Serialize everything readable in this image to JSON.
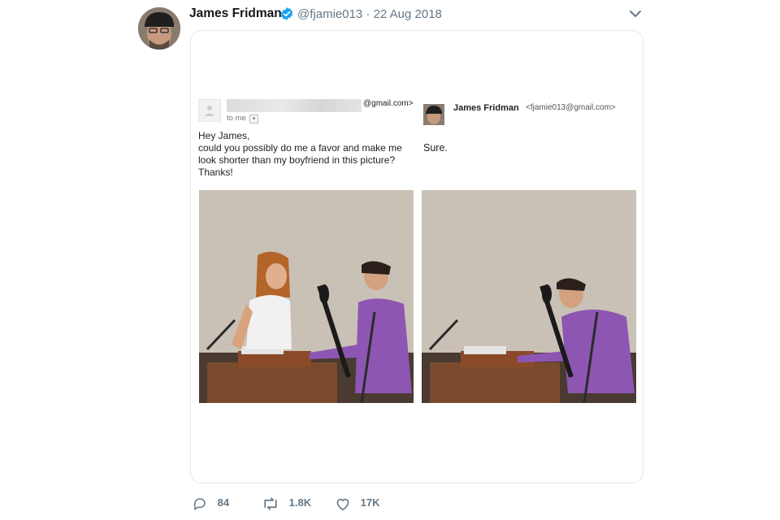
{
  "tweet": {
    "author_name": "James Fridman",
    "handle": "@fjamie013",
    "separator": "·",
    "date": "22 Aug 2018",
    "verified": true
  },
  "email_left": {
    "sender_domain": "@gmail.com>",
    "to_me": "to me",
    "body_lines": [
      "Hey James,",
      "could you possibly do me a favor and make me",
      "look shorter than my boyfriend in this picture?",
      "Thanks!"
    ]
  },
  "email_right": {
    "sender_name": "James Fridman",
    "sender_email": "<fjamie013@gmail.com>",
    "body": "Sure."
  },
  "actions": {
    "replies": "84",
    "retweets": "1.8K",
    "likes": "17K"
  },
  "icons": [
    "verified-badge-icon",
    "chevron-down-icon",
    "reply-icon",
    "retweet-icon",
    "like-icon"
  ],
  "colors": {
    "accent": "#1da1f2",
    "muted": "#657786",
    "border": "#e1e8ed"
  }
}
